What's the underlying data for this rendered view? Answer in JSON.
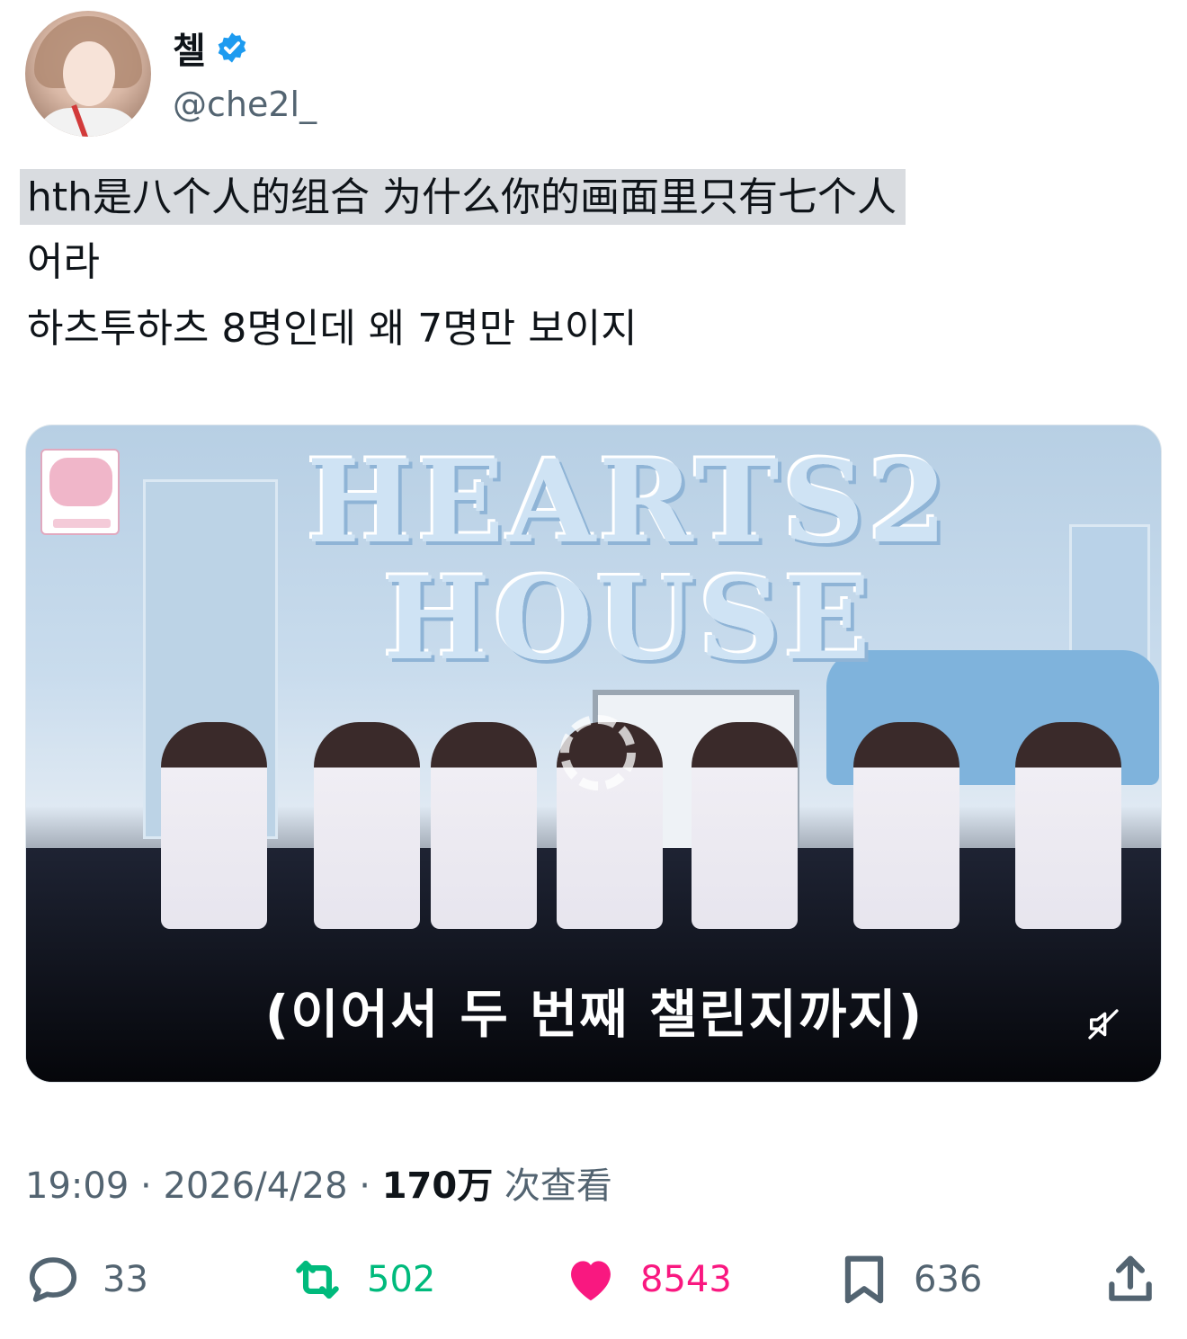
{
  "author": {
    "display_name": "첼",
    "handle": "@che2l_",
    "verified_color": "#1d9bf0"
  },
  "tweet": {
    "line1": "hth是八个人的组合 为什么你的画面里只有七个人",
    "line2": "어라",
    "line3": "하츠투하츠 8명인데 왜 7명만 보이지"
  },
  "media": {
    "banner_text": "HEARTS2 HOUSE",
    "caption": "(이어서 두 번째 챌린지까지)",
    "muted_icon": "muted-speaker-icon"
  },
  "meta": {
    "time": "19:09",
    "separator": " · ",
    "date": "2026/4/28",
    "views_count": "170万",
    "views_label": "次查看"
  },
  "actions": {
    "reply_count": "33",
    "retweet_count": "502",
    "like_count": "8543",
    "bookmark_count": "636",
    "colors": {
      "retweet": "#00ba7c",
      "like": "#f91880",
      "neutral": "#536471"
    }
  }
}
